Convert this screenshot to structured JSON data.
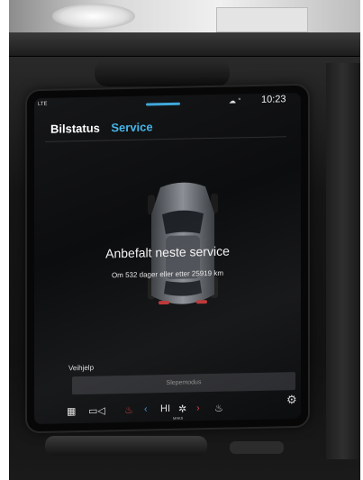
{
  "status_bar": {
    "network": "LTE",
    "icons": "☁ °",
    "time": "10:23"
  },
  "tabs": [
    {
      "label": "Bilstatus",
      "active": false
    },
    {
      "label": "Service",
      "active": true
    }
  ],
  "service": {
    "title": "Anbefalt neste service",
    "subtitle": "Om 532 dager eller etter 25919 km"
  },
  "assist": {
    "label": "Veihjelp",
    "tow_button": "Slepemodus"
  },
  "bottom_bar": {
    "fan_label": "HI",
    "fan_sub": "MAKS"
  },
  "colors": {
    "accent": "#41b4e8",
    "screen_bg": "#0c0d0f",
    "button_bg": "#2a2b2e"
  }
}
